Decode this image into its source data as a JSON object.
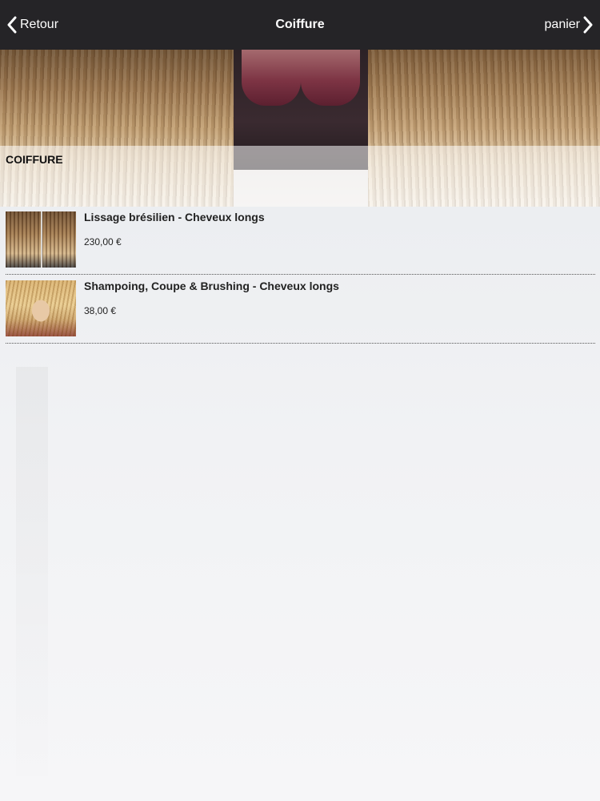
{
  "navbar": {
    "back_label": "Retour",
    "title": "Coiffure",
    "cart_label": "panier",
    "background_color": "#252427",
    "text_color": "#ffffff"
  },
  "hero": {
    "title": "COIFFURE"
  },
  "products": [
    {
      "name": "Lissage brésilien - Cheveux longs",
      "price": "230,00 €",
      "thumb_icon": "hair-straightening-photo"
    },
    {
      "name": "Shampoing, Coupe & Brushing - Cheveux longs",
      "price": "38,00 €",
      "thumb_icon": "blonde-haircut-photo"
    }
  ]
}
